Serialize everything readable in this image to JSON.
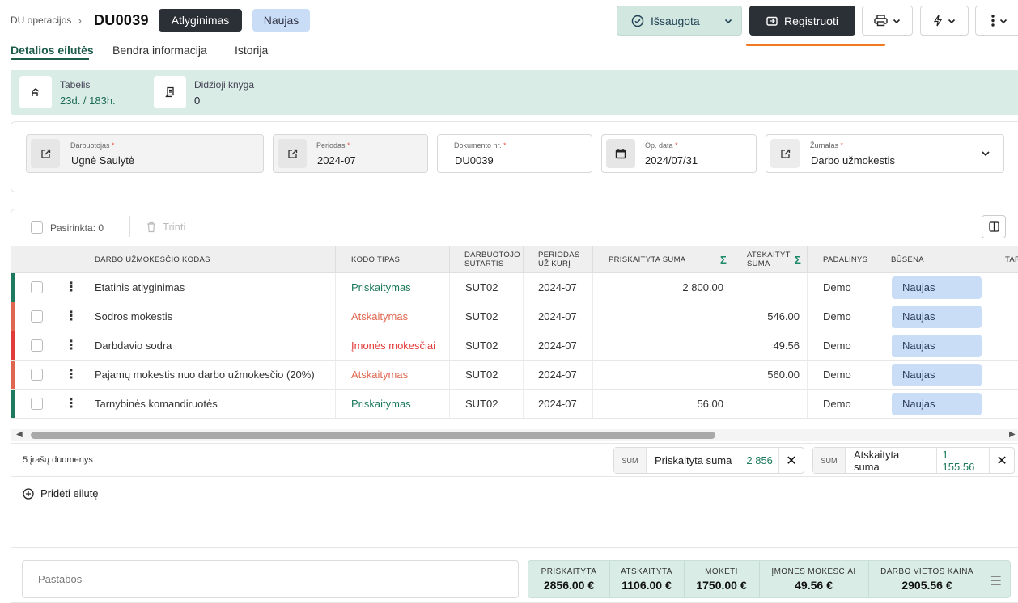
{
  "header": {
    "breadcrumb": "DU operacijos",
    "doc_id": "DU0039",
    "type_badge": "Atlyginimas",
    "status_badge": "Naujas",
    "saved_label": "Išsaugota",
    "register_label": "Registruoti"
  },
  "tabs": [
    "Detalios eilutės",
    "Bendra informacija",
    "Istorija"
  ],
  "info": {
    "tabelis_label": "Tabelis",
    "tabelis_value": "23d. / 183h.",
    "ledger_label": "Didžioji knyga",
    "ledger_value": "0"
  },
  "form": {
    "employee_label": "Darbuotojas",
    "employee_value": "Ugnė Saulytė",
    "period_label": "Periodas",
    "period_value": "2024-07",
    "docnr_label": "Dokumento nr.",
    "docnr_value": "DU0039",
    "opdate_label": "Op. data",
    "opdate_value": "2024/07/31",
    "journal_label": "Žurnalas",
    "journal_value": "Darbo užmokestis"
  },
  "toolbar": {
    "selected": "Pasirinkta: 0",
    "delete": "Trinti"
  },
  "table": {
    "headers": {
      "code": "Darbo užmokesčio kodas",
      "type": "Kodo tipas",
      "contract": "Darbuotojo sutartis",
      "period": "Periodas už kurį",
      "accrued": "Priskaityta suma",
      "deducted": "Atskaityt suma",
      "unit": "Padalinys",
      "status": "Būsena",
      "next": "Tar"
    },
    "rows": [
      {
        "code": "Etatinis atlyginimas",
        "type": "Priskaitymas",
        "contract": "SUT02",
        "period": "2024-07",
        "accrued": "2 800.00",
        "deducted": "",
        "unit": "Demo",
        "status": "Naujas"
      },
      {
        "code": "Sodros mokestis",
        "type": "Atskaitymas",
        "contract": "SUT02",
        "period": "2024-07",
        "accrued": "",
        "deducted": "546.00",
        "unit": "Demo",
        "status": "Naujas"
      },
      {
        "code": "Darbdavio sodra",
        "type": "Įmonės mokesčiai",
        "contract": "SUT02",
        "period": "2024-07",
        "accrued": "",
        "deducted": "49.56",
        "unit": "Demo",
        "status": "Naujas"
      },
      {
        "code": "Pajamų mokestis nuo darbo užmokesčio (20%)",
        "type": "Atskaitymas",
        "contract": "SUT02",
        "period": "2024-07",
        "accrued": "",
        "deducted": "560.00",
        "unit": "Demo",
        "status": "Naujas"
      },
      {
        "code": "Tarnybinės komandiruotės",
        "type": "Priskaitymas",
        "contract": "SUT02",
        "period": "2024-07",
        "accrued": "56.00",
        "deducted": "",
        "unit": "Demo",
        "status": "Naujas"
      }
    ]
  },
  "colors": {
    "accrual": "#1d7a5e",
    "deduction": "#e0674f",
    "company_tax": "#e23b3b",
    "accent_dark": "#2b3037",
    "orange": "#f07a24"
  },
  "footer": {
    "records": "5 įrašų duomenys",
    "sum_tag": "SUM",
    "sum1_label": "Priskaityta suma",
    "sum1_value": "2 856",
    "sum2_label": "Atskaityta suma",
    "sum2_value": "1 155.56",
    "add_row": "Pridėti eilutę",
    "notes_placeholder": "Pastabos"
  },
  "totals": [
    {
      "label": "Priskaityta",
      "value": "2856.00 €"
    },
    {
      "label": "Atskaityta",
      "value": "1106.00 €"
    },
    {
      "label": "Mokėti",
      "value": "1750.00 €"
    },
    {
      "label": "Įmonės mokesčiai",
      "value": "49.56 €"
    },
    {
      "label": "Darbo vietos kaina",
      "value": "2905.56 €"
    }
  ]
}
